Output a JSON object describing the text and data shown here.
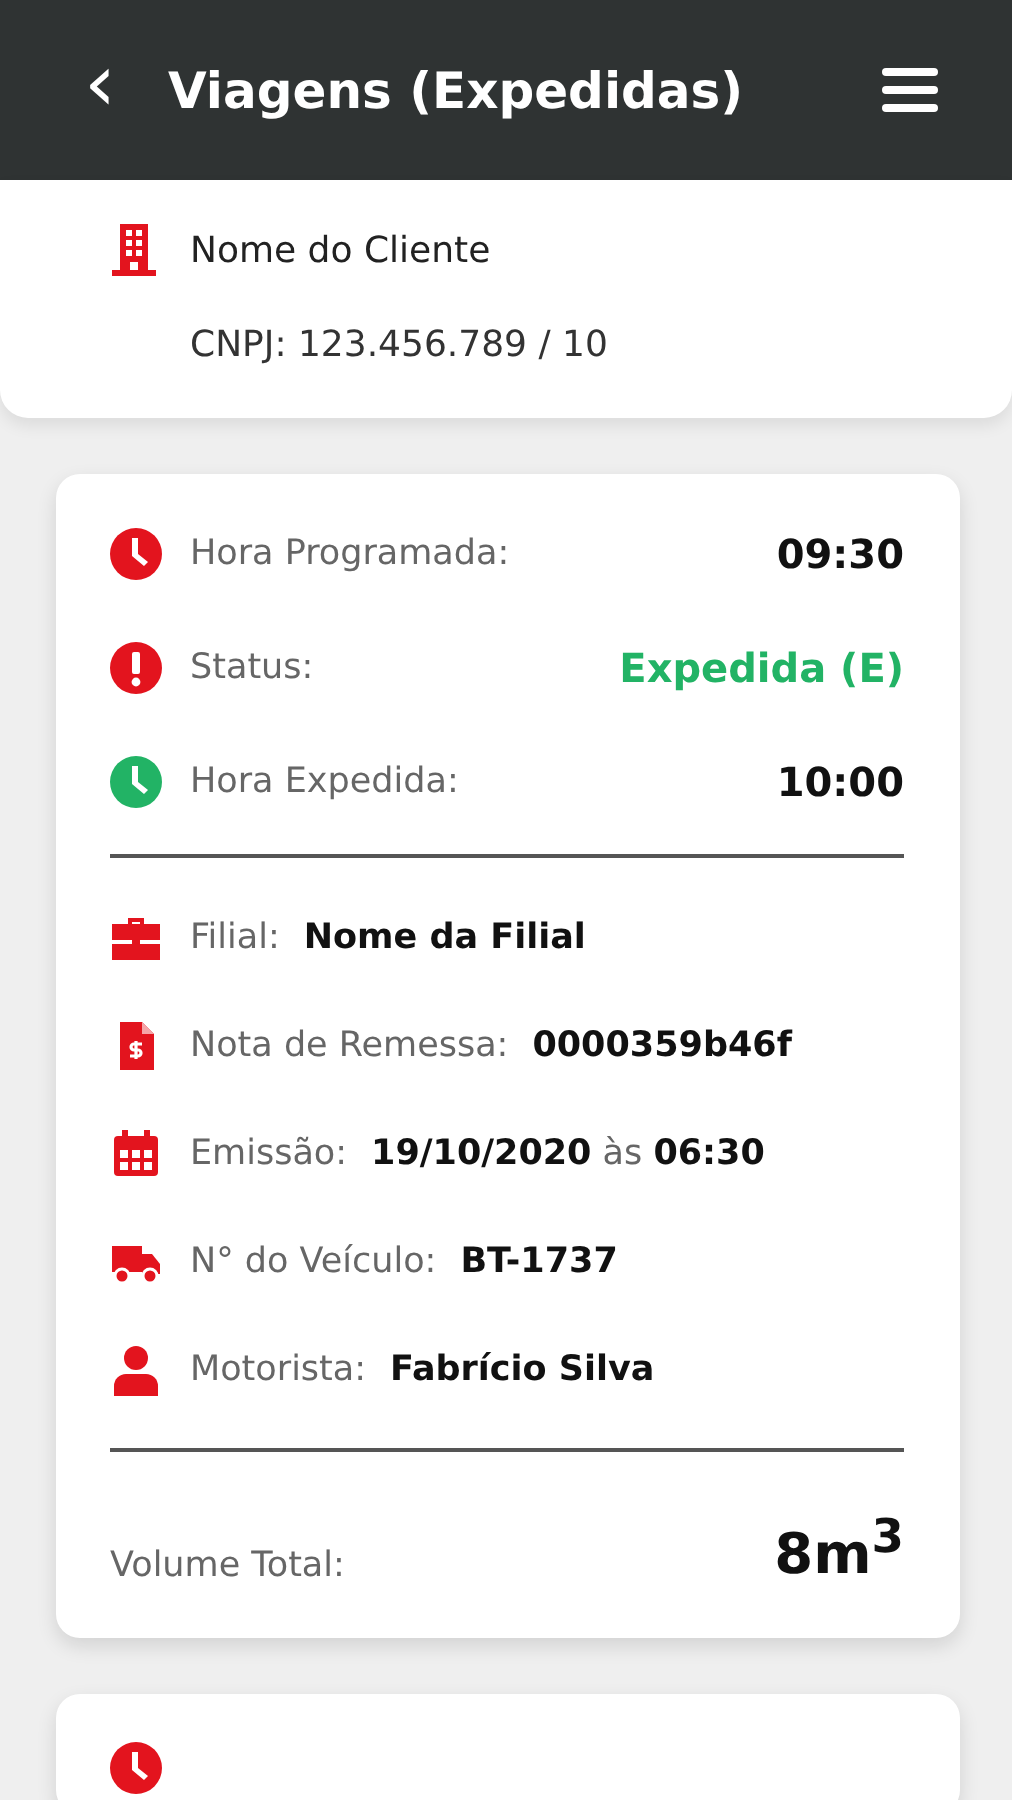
{
  "header": {
    "back": "‹",
    "title": "Viagens (Expedidas)"
  },
  "client": {
    "name": "Nome do Cliente",
    "cnpj": "CNPJ: 123.456.789 / 10"
  },
  "trip": {
    "times": [
      {
        "kind": "time",
        "color": "#e3141e",
        "label": "Hora Programada:",
        "value": "09:30"
      },
      {
        "kind": "status",
        "color": "#e3141e",
        "label": "Status:",
        "value": "Expedida (E)"
      },
      {
        "kind": "time",
        "color": "#22b365",
        "label": "Hora Expedida:",
        "value": "10:00"
      }
    ],
    "details": [
      {
        "kind": "briefcase",
        "label": "Filial:",
        "value": "**Nome da Filial**"
      },
      {
        "kind": "invoice",
        "label": "Nota de Remessa:",
        "value": "**0000359b46f**"
      },
      {
        "kind": "calendar",
        "label": "Emissão:",
        "value": "**19/10/2020** às **06:30**"
      },
      {
        "kind": "truck",
        "label": "N° do Veículo:",
        "value": "**BT-1737**"
      },
      {
        "kind": "person",
        "label": "Motorista:",
        "value": "**Fabrício Silva**"
      }
    ],
    "volume_label": "Volume Total:",
    "volume_value": "8m$^{3}$"
  },
  "next_trip": {
    "kind": "clock",
    "color": "#e3141e"
  }
}
